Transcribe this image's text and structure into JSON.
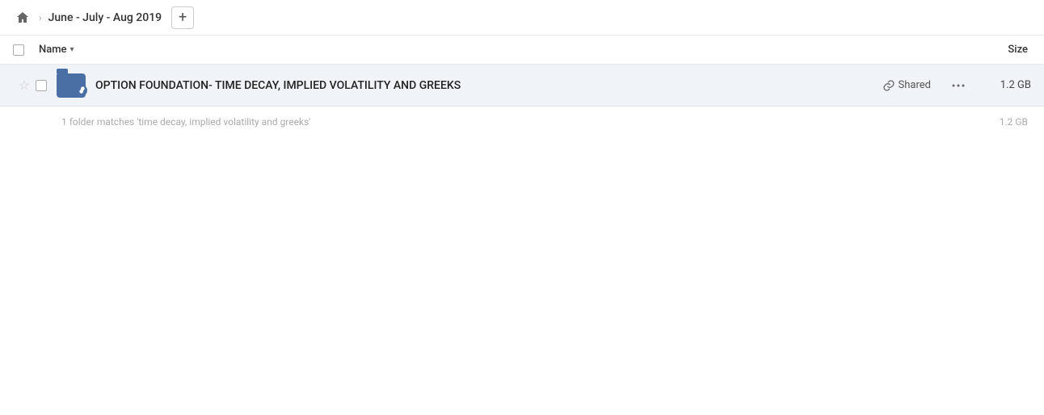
{
  "topbar": {
    "home_label": "Home",
    "breadcrumb_text": "June - July - Aug 2019",
    "add_button_label": "+"
  },
  "columns": {
    "name_label": "Name",
    "size_label": "Size"
  },
  "file_row": {
    "name": "OPTION FOUNDATION- TIME DECAY, IMPLIED VOLATILITY AND GREEKS",
    "shared_label": "Shared",
    "size": "1.2 GB"
  },
  "footer": {
    "match_text": "1 folder matches 'time decay, implied volatility and greeks'",
    "match_size": "1.2 GB"
  },
  "icons": {
    "home": "⌂",
    "star": "☆",
    "link": "🔗",
    "more": "···",
    "sort_arrow": "▾"
  }
}
